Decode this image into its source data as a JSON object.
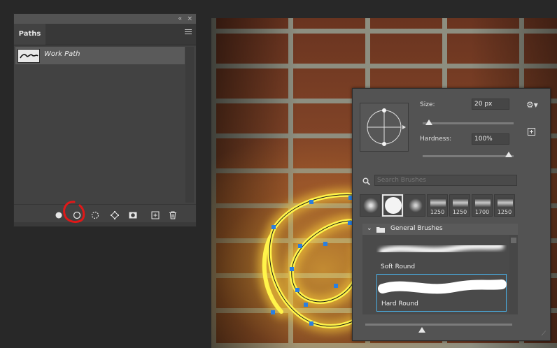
{
  "paths_panel": {
    "collapse_glyph": "«",
    "close_glyph": "×",
    "tab_label": "Paths",
    "path_name": "Work Path",
    "footer_icons": [
      "fill-path-icon",
      "stroke-path-icon",
      "load-path-as-selection-icon",
      "make-work-path-icon",
      "add-mask-icon",
      "new-path-icon",
      "delete-path-icon"
    ]
  },
  "brush_picker": {
    "size_label": "Size:",
    "size_value": "20 px",
    "size_level_percent": 3,
    "hardness_label": "Hardness:",
    "hardness_value": "100%",
    "hardness_level_percent": 100,
    "search_placeholder": "Search Brushes",
    "recent_brushes": [
      {
        "kind": "soft-round",
        "label": ""
      },
      {
        "kind": "hard-round",
        "label": ""
      },
      {
        "kind": "soft-round",
        "label": ""
      },
      {
        "kind": "texture",
        "label": "1250"
      },
      {
        "kind": "texture",
        "label": "1250"
      },
      {
        "kind": "texture",
        "label": "1700"
      },
      {
        "kind": "texture",
        "label": "1250"
      }
    ],
    "group_name": "General Brushes",
    "brushes": [
      {
        "name": "Soft Round",
        "selected": false
      },
      {
        "name": "Hard Round",
        "selected": true
      }
    ]
  },
  "colors": {
    "accent": "#4ab0e6",
    "neon": "#fff44a",
    "anchor": "#2a7fe0",
    "annotation": "#e01818"
  }
}
